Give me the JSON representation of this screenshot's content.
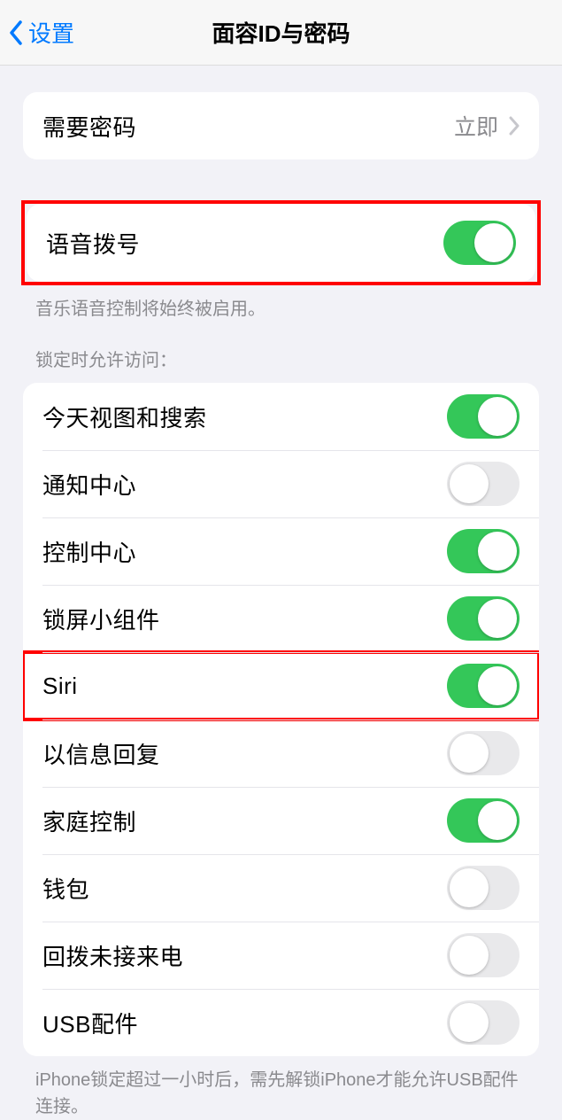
{
  "nav": {
    "back_label": "设置",
    "title": "面容ID与密码"
  },
  "passcode": {
    "label": "需要密码",
    "value": "立即"
  },
  "voice_dial": {
    "label": "语音拨号",
    "on": true,
    "note": "音乐语音控制将始终被启用。"
  },
  "lock_header": "锁定时允许访问：",
  "lock_items": [
    {
      "label": "今天视图和搜索",
      "on": true
    },
    {
      "label": "通知中心",
      "on": false
    },
    {
      "label": "控制中心",
      "on": true
    },
    {
      "label": "锁屏小组件",
      "on": true
    },
    {
      "label": "Siri",
      "on": true
    },
    {
      "label": "以信息回复",
      "on": false
    },
    {
      "label": "家庭控制",
      "on": true
    },
    {
      "label": "钱包",
      "on": false
    },
    {
      "label": "回拨未接来电",
      "on": false
    },
    {
      "label": "USB配件",
      "on": false
    }
  ],
  "usb_note": "iPhone锁定超过一小时后，需先解锁iPhone才能允许USB配件连接。"
}
